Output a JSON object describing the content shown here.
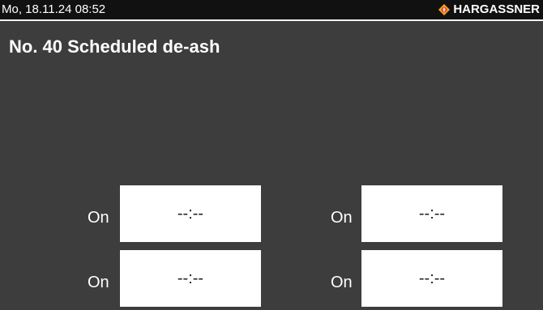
{
  "status_bar": {
    "datetime": "Mo, 18.11.24 08:52",
    "brand": "HARGASSNER",
    "brand_icon": "hargassner-logo-icon",
    "accent_color": "#f5a623"
  },
  "screen": {
    "title": "No. 40 Scheduled de-ash"
  },
  "slots": [
    {
      "label": "On",
      "time": "--:--"
    },
    {
      "label": "On",
      "time": "--:--"
    },
    {
      "label": "On",
      "time": "--:--"
    },
    {
      "label": "On",
      "time": "--:--"
    }
  ],
  "colors": {
    "background": "#3d3d3d",
    "status_bar": "#111111",
    "field": "#ffffff",
    "text": "#ffffff"
  }
}
